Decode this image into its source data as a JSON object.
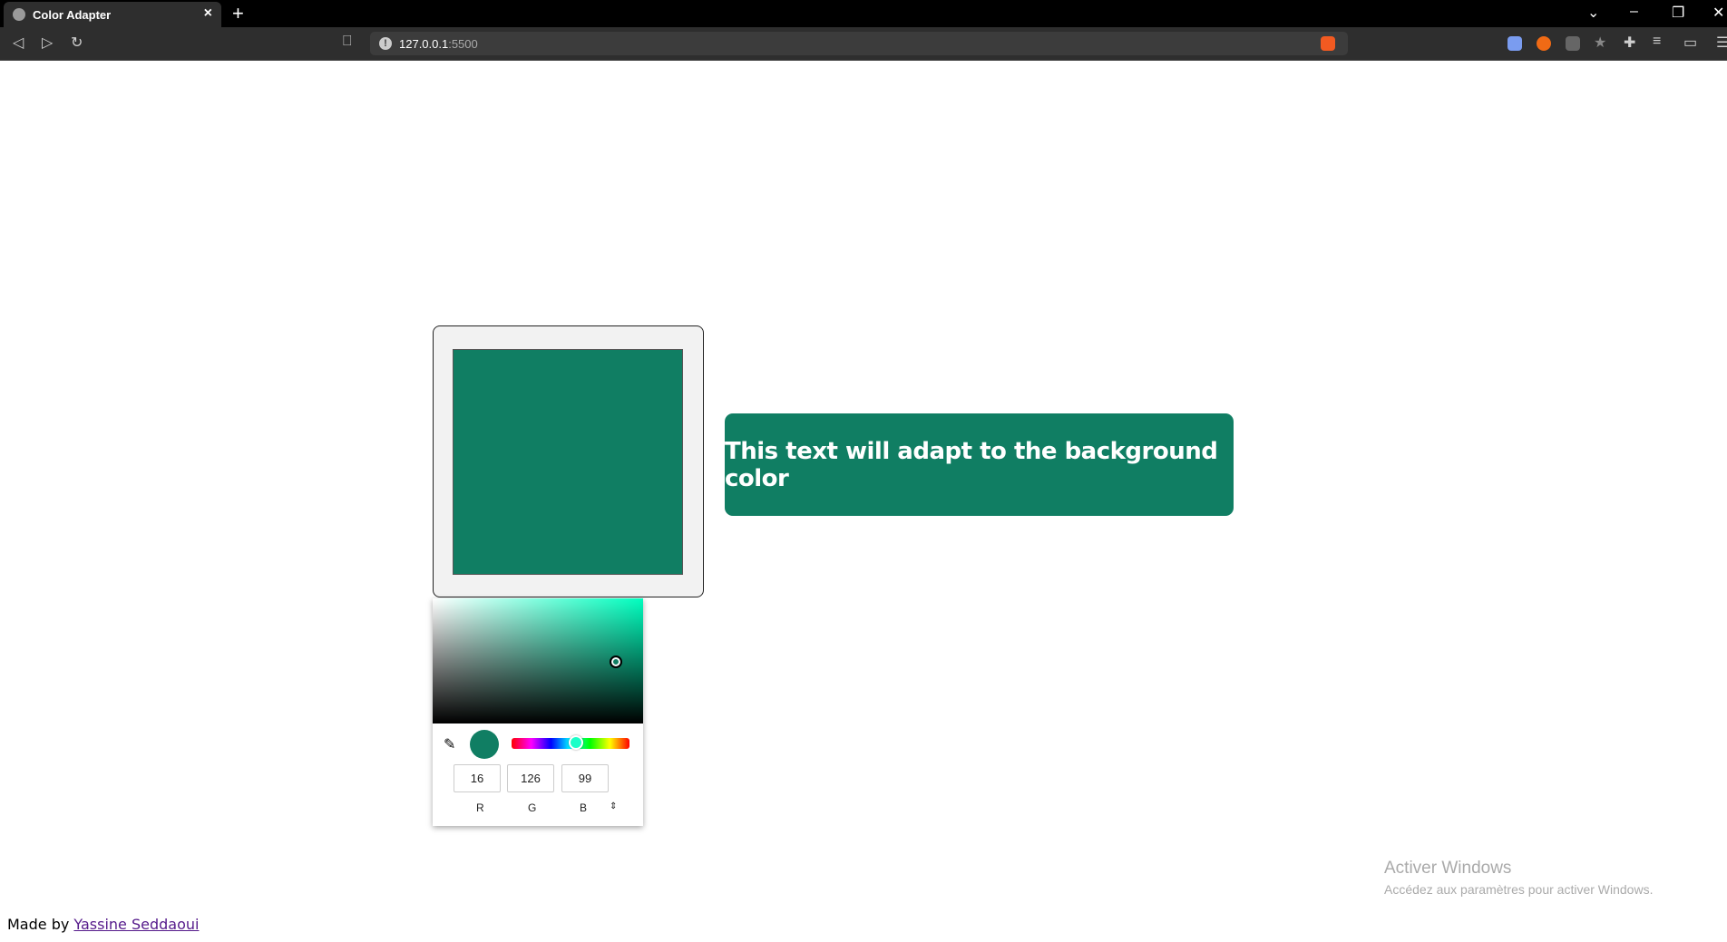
{
  "browser": {
    "tab_title": "Color Adapter",
    "new_tab": "+",
    "close": "×",
    "url_host": "127.0.0.1",
    "url_port": ":5500"
  },
  "app": {
    "color_hex": "#107e63",
    "adaptive_text": "This text will adapt to the background color",
    "text_color": "#ffffff",
    "picker": {
      "r": "16",
      "g": "126",
      "b": "99",
      "label_r": "R",
      "label_g": "G",
      "label_b": "B",
      "mode_toggle": "⇕"
    }
  },
  "footer": {
    "prefix": "Made by ",
    "author": "Yassine Seddaoui"
  },
  "watermark": {
    "title": "Activer Windows",
    "subtitle": "Accédez aux paramètres pour activer Windows."
  }
}
